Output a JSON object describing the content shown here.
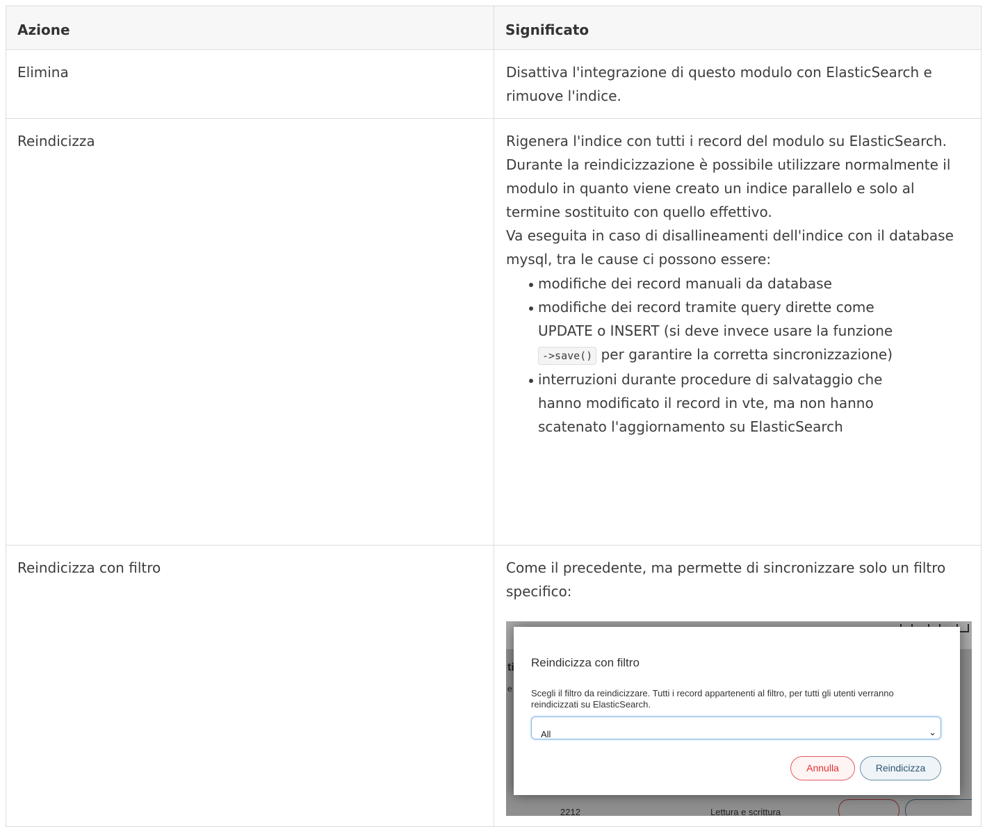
{
  "table": {
    "headers": [
      "Azione",
      "Significato"
    ],
    "rows": [
      {
        "action": "Elimina",
        "meaning": "Disattiva l'integrazione di questo modulo con ElasticSearch e rimuove l'indice."
      },
      {
        "action": "Reindicizza",
        "meaning_p1": "Rigenera l'indice con tutti i record del modulo su ElasticSearch. Durante la reindicizzazione è possibile utilizzare normalmente il modulo in quanto viene creato un indice parallelo e solo al termine sostituito con quello effettivo.",
        "meaning_p2": "Va eseguita in caso di disallineamenti dell'indice con il database mysql, tra le cause ci possono essere:",
        "bullets": {
          "b1": "modifiche dei record manuali da database",
          "b2_before": "modifiche dei record tramite query dirette come UPDATE o INSERT (si deve invece usare la funzione",
          "b2_code": "->save()",
          "b2_after": "per garantire la corretta sincronizzazione)",
          "b3": "interruzioni durante procedure di salvataggio che hanno modificato il record in vte, ma non hanno scatenato l'aggiornamento su ElasticSearch"
        }
      },
      {
        "action": "Reindicizza con filtro",
        "meaning": "Come il precedente, ma permette di sincronizzare solo un filtro specifico:"
      }
    ]
  },
  "screenshot": {
    "dialog": {
      "title": "Reindicizza con filtro",
      "text": "Scegli il filtro da reindicizzare. Tutti i record appartenenti al filtro, per tutti gli utenti verranno reindicizzati su ElasticSearch.",
      "select_value": "All",
      "cancel_label": "Annulla",
      "confirm_label": "Reindicizza"
    },
    "background": {
      "side_letter_1": "ti",
      "side_letter_2": "e",
      "row_id": "2212",
      "row_label": "Lettura e scrittura"
    }
  }
}
